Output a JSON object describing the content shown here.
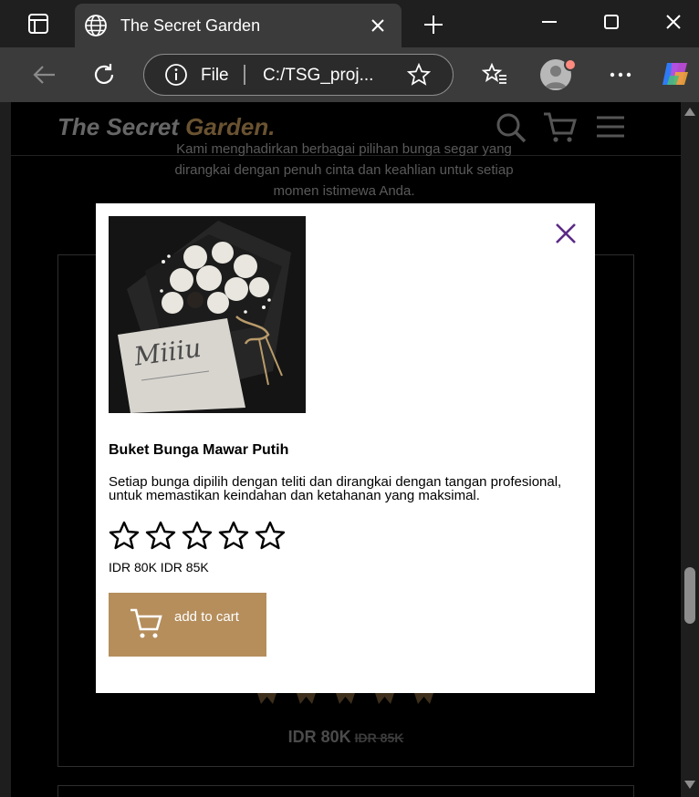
{
  "browser": {
    "tab_title": "The Secret Garden",
    "address_scheme": "File",
    "address_url": "C:/TSG_proj..."
  },
  "site": {
    "logo_part1": "The Secret ",
    "logo_part2": "Garden.",
    "hero_line1": "Kami menghadirkan berbagai pilihan bunga segar yang",
    "hero_line2": "dirangkai dengan penuh cinta dan keahlian untuk setiap",
    "hero_line3": "momen istimewa Anda.",
    "bg_price_now": "IDR 80K",
    "bg_price_old": "IDR 85K"
  },
  "modal": {
    "product_title": "Buket Bunga Mawar Putih",
    "product_description": "Setiap bunga dipilih dengan teliti dan dirangkai dengan tangan profesional, untuk memastikan keindahan dan ketahanan yang maksimal.",
    "price_text": "IDR 80K IDR 85K",
    "rating_stars_filled": 0,
    "rating_stars_total": 5,
    "add_to_cart_label": "add to cart",
    "image_card_title": "Miiiu"
  },
  "colors": {
    "accent_brown": "#b58e5c",
    "close_purple": "#5b2a86",
    "page_background": "#000000"
  },
  "icons": [
    "window-icon",
    "globe-icon",
    "close-icon",
    "plus-icon",
    "minimize-icon",
    "maximize-icon",
    "back-icon",
    "refresh-icon",
    "info-icon",
    "star-icon",
    "favorites-icon",
    "more-icon",
    "copilot-icon",
    "search-icon",
    "cart-icon",
    "menu-icon"
  ]
}
